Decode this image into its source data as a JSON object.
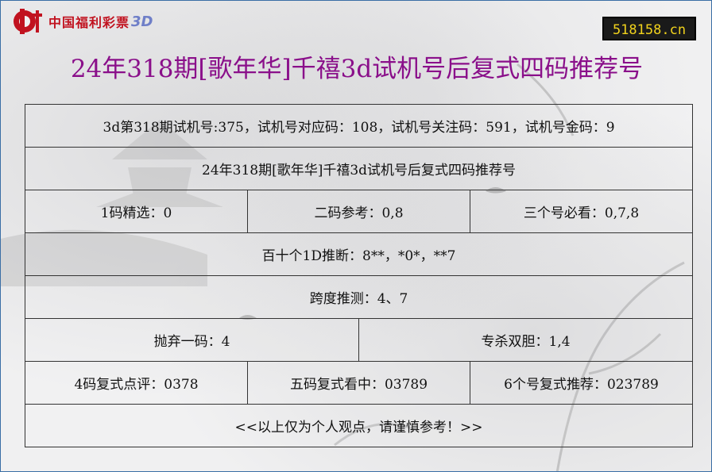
{
  "logo": {
    "icon": "cwl-lottery-logo-icon",
    "text": "中国福利彩票",
    "suffix": "3D"
  },
  "site_badge": "518158.cn",
  "page_title": "24年318期[歌年华]千禧3d试机号后复式四码推荐号",
  "rows": {
    "trial_numbers": "3d第318期试机号:375，试机号对应码：108，试机号关注码：591，试机号金码：9",
    "recommend_title": "24年318期[歌年华]千禧3d试机号后复式四码推荐号",
    "one_code": "1码精选：0",
    "two_code": "二码参考：0,8",
    "three_numbers": "三个号必看：0,7,8",
    "position_1d": "百十个1D推断：8**，*0*，**7",
    "span": "跨度推测：4、7",
    "discard_one": "抛弃一码：4",
    "kill_pair": "专杀双胆：1,4",
    "four_code_compound": "4码复式点评：0378",
    "five_code_compound": "五码复式看中：03789",
    "six_code_compound": "6个号复式推荐：023789",
    "disclaimer": "<<以上仅为个人观点，请谨慎参考！>>"
  },
  "colors": {
    "title": "#8a0f8a",
    "logo_red": "#c1121f",
    "badge_bg": "#1a1a1a",
    "badge_text": "#f1d21c",
    "frame_border": "#3a6ea5"
  }
}
